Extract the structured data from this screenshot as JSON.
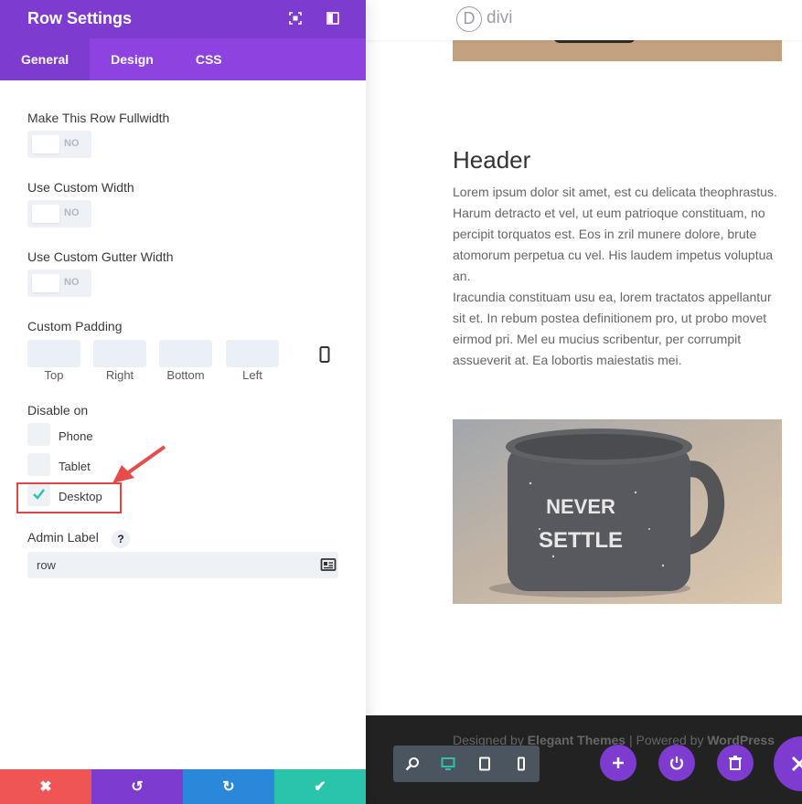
{
  "panel": {
    "title": "Row Settings",
    "tabs": [
      {
        "label": "General"
      },
      {
        "label": "Design"
      },
      {
        "label": "CSS"
      }
    ]
  },
  "fields": {
    "fullwidth": {
      "label": "Make This Row Fullwidth",
      "value": "NO"
    },
    "custom_width": {
      "label": "Use Custom Width",
      "value": "NO"
    },
    "custom_gutter": {
      "label": "Use Custom Gutter Width",
      "value": "NO"
    },
    "padding": {
      "label": "Custom Padding",
      "top": "Top",
      "right": "Right",
      "bottom": "Bottom",
      "left": "Left"
    },
    "disable_on": {
      "label": "Disable on",
      "options": [
        {
          "label": "Phone",
          "checked": false
        },
        {
          "label": "Tablet",
          "checked": false
        },
        {
          "label": "Desktop",
          "checked": true
        }
      ]
    },
    "admin_label": {
      "label": "Admin Label",
      "help": "?",
      "value": "row"
    }
  },
  "bottom_bar": {
    "cancel": "✖",
    "undo": "↺",
    "redo": "↻",
    "save": "✔"
  },
  "preview": {
    "logo_letter": "D",
    "logo_text": "divi",
    "heading": "Header",
    "paragraph1": "Lorem ipsum dolor sit amet, est cu delicata theophrastus. Harum detracto et vel, ut eum patrioque constituam, no percipit torquatos est. Eos in zril munere dolore, brute atomorum perpetua cu vel. His laudem impetus voluptua an.",
    "paragraph2": "Iracundia constituam usu ea, lorem tractatos appellantur sit et. In rebum postea definitionem pro, ut probo movet eirmod pri. Mel eu mucius scribentur, per corrumpit assueverit at. Ea lobortis maiestatis mei.",
    "mug_text_line1": "NEVER",
    "mug_text_line2": "SETTLE",
    "footer": {
      "designed_by": "Designed by",
      "elegant": "Elegant Themes",
      "sep": " | Powered by ",
      "wordpress": "WordPress"
    }
  },
  "colors": {
    "purple": "#7e3bd0",
    "tab_purple": "#8e42e0",
    "cancel_red": "#ef5555",
    "undo_purple": "#7e3bd0",
    "redo_blue": "#2b87da",
    "save_green": "#29c4a9",
    "highlight_red": "#e04646"
  }
}
